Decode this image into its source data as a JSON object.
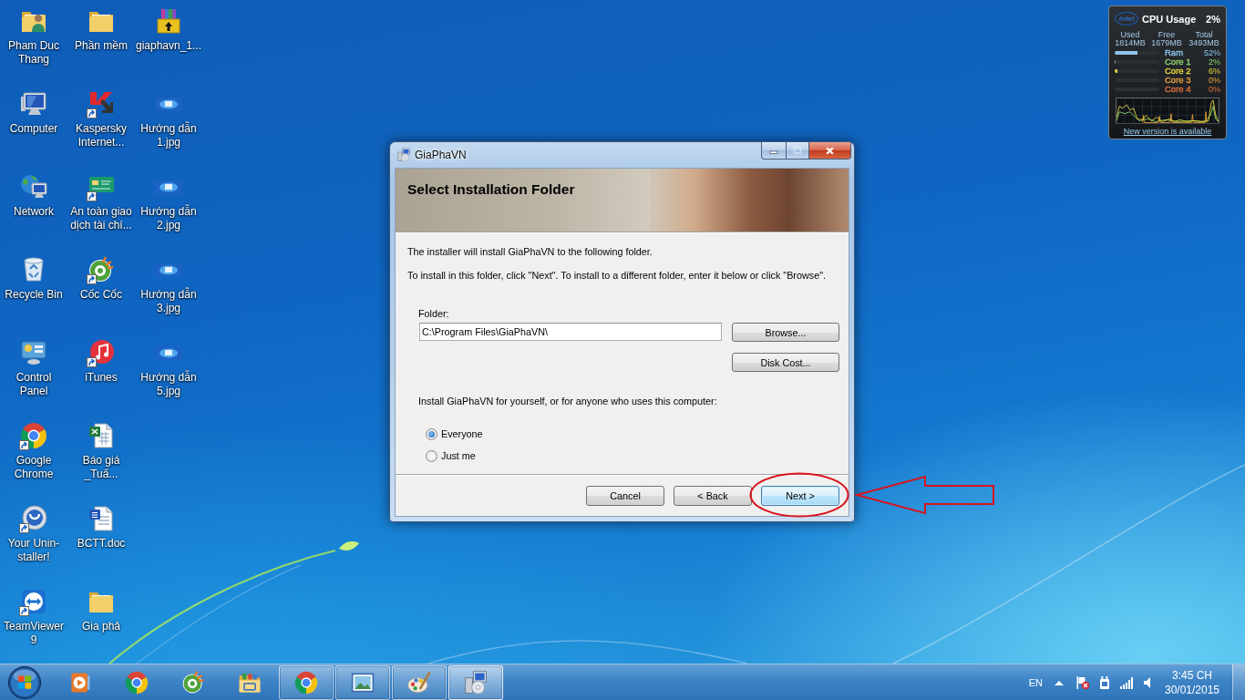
{
  "desktop_icons": [
    {
      "label": "Pham Duc Thang",
      "kind": "user-folder",
      "shortcut": false
    },
    {
      "label": "Computer",
      "kind": "computer",
      "shortcut": false
    },
    {
      "label": "Network",
      "kind": "network",
      "shortcut": false
    },
    {
      "label": "Recycle Bin",
      "kind": "recycle-bin",
      "shortcut": false
    },
    {
      "label": "Control Panel",
      "kind": "control-panel",
      "shortcut": false
    },
    {
      "label": "Google Chrome",
      "kind": "chrome",
      "shortcut": true
    },
    {
      "label": "Your Unin-staller!",
      "kind": "uninstaller",
      "shortcut": true
    },
    {
      "label": "TeamViewer 9",
      "kind": "teamviewer",
      "shortcut": true
    },
    {
      "label": "Phần mềm",
      "kind": "folder",
      "shortcut": false
    },
    {
      "label": "Kaspersky Internet...",
      "kind": "kaspersky",
      "shortcut": true
    },
    {
      "label": "An toàn giao dịch tài chí...",
      "kind": "bank-app",
      "shortcut": true
    },
    {
      "label": "Cốc Cốc",
      "kind": "coccoc",
      "shortcut": true
    },
    {
      "label": "iTunes",
      "kind": "itunes",
      "shortcut": true
    },
    {
      "label": "Báo giá _Tuấ...",
      "kind": "spreadsheet",
      "shortcut": false
    },
    {
      "label": "BCTT.doc",
      "kind": "word-document",
      "shortcut": false
    },
    {
      "label": "Gia phả",
      "kind": "folder",
      "shortcut": false
    },
    {
      "label": "giaphavn_1...",
      "kind": "archive",
      "shortcut": false
    },
    {
      "label": "Hướng dẫn 1.jpg",
      "kind": "image",
      "shortcut": false
    },
    {
      "label": "Hướng dẫn 2.jpg",
      "kind": "image",
      "shortcut": false
    },
    {
      "label": "Hướng dẫn 3.jpg",
      "kind": "image",
      "shortcut": false
    },
    {
      "label": "Hướng dẫn 5.jpg",
      "kind": "image",
      "shortcut": false
    }
  ],
  "cpu_gadget": {
    "logo": "intel",
    "title": "CPU Usage",
    "usage": "2%",
    "memory": [
      {
        "header": "Used",
        "value": "1814MB"
      },
      {
        "header": "Free",
        "value": "1679MB"
      },
      {
        "header": "Total",
        "value": "3493MB"
      }
    ],
    "meters": [
      {
        "label": "Ram",
        "reading": "52%",
        "level": 0.52,
        "color": "#8ec5ea"
      },
      {
        "label": "Core 1",
        "reading": "2%",
        "level": 0.02,
        "color": "#8fd46a"
      },
      {
        "label": "Core 2",
        "reading": "6%",
        "level": 0.06,
        "color": "#e6d83a"
      },
      {
        "label": "Core 3",
        "reading": "0%",
        "color": "#e8a23a"
      },
      {
        "label": "Core 4",
        "reading": "0%",
        "color": "#e2703a"
      }
    ],
    "link": "New version is available"
  },
  "installer_window": {
    "title": "GiaPhaVN",
    "controls": [
      {
        "kind": "minimize",
        "disabled": false
      },
      {
        "kind": "maximize",
        "disabled": true
      },
      {
        "kind": "close",
        "disabled": false
      }
    ],
    "heading": "Select Installation Folder",
    "intro": "The installer will install GiaPhaVN to the following folder.",
    "instructions": "To install in this folder, click \"Next\". To install to a different folder, enter it below or click \"Browse\".",
    "folder_label": "Folder:",
    "folder_value": "C:\\Program Files\\GiaPhaVN\\",
    "folder_buttons": [
      "Browse...",
      "Disk Cost..."
    ],
    "scope_question": "Install GiaPhaVN for yourself, or for anyone who uses this computer:",
    "scope_options": [
      {
        "label": "Everyone",
        "selected": true
      },
      {
        "label": "Just me",
        "selected": false
      }
    ],
    "footer_buttons": [
      {
        "label": "Cancel",
        "default": false
      },
      {
        "label": "< Back",
        "default": false
      },
      {
        "label": "Next >",
        "default": true
      }
    ]
  },
  "taskbar": {
    "items": [
      {
        "kind": "media-player",
        "running": false,
        "active": false
      },
      {
        "kind": "chrome",
        "running": false,
        "active": false
      },
      {
        "kind": "coccoc",
        "running": false,
        "active": false
      },
      {
        "kind": "explorer",
        "running": false,
        "active": false
      },
      {
        "kind": "chrome",
        "running": true,
        "active": false
      },
      {
        "kind": "photo-viewer",
        "running": true,
        "active": false
      },
      {
        "kind": "paint",
        "running": true,
        "active": false
      },
      {
        "kind": "installer",
        "running": true,
        "active": true
      }
    ],
    "language": "EN",
    "time": "3:45 CH",
    "date": "30/01/2015"
  }
}
